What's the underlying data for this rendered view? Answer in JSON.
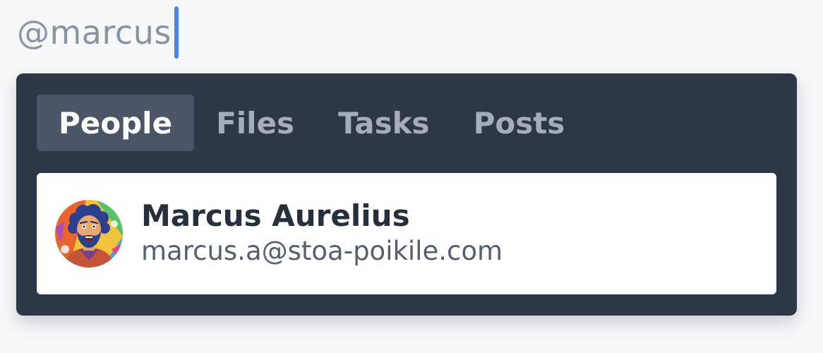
{
  "mention": {
    "query": "@marcus"
  },
  "tabs": [
    {
      "label": "People",
      "active": true
    },
    {
      "label": "Files",
      "active": false
    },
    {
      "label": "Tasks",
      "active": false
    },
    {
      "label": "Posts",
      "active": false
    }
  ],
  "results": [
    {
      "name": "Marcus Aurelius",
      "email": "marcus.a@stoa-poikile.com",
      "avatar": "illustrated-portrait-avatar"
    }
  ],
  "colors": {
    "caret": "#4a86d6",
    "panel_background": "#2d3846",
    "active_tab_background": "#4a5668",
    "inactive_tab_text": "#a4adb8"
  }
}
